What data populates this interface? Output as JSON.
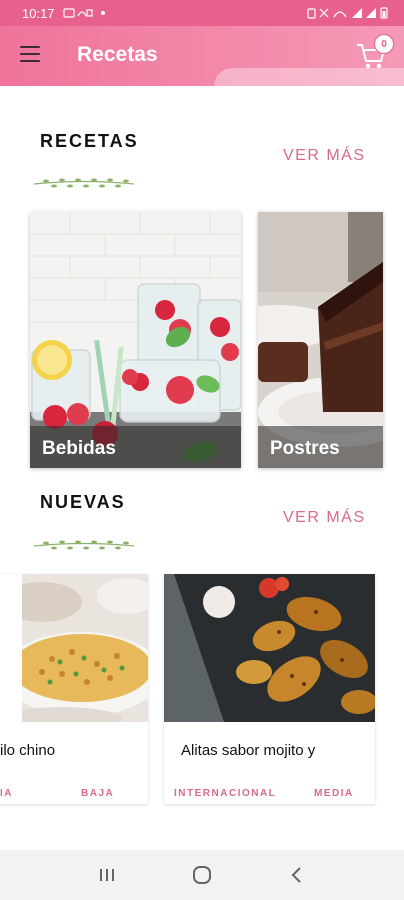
{
  "status_bar": {
    "time": "10:17"
  },
  "app_bar": {
    "title": "Recetas",
    "cart_count": "0"
  },
  "recetas_section": {
    "title": "RECETAS",
    "see_more": "VER MÁS",
    "cards": [
      {
        "label": "Bebidas"
      },
      {
        "label": "Postres"
      }
    ]
  },
  "nuevas_section": {
    "title": "NUEVAS",
    "see_more": "VER MÁS",
    "cards": [
      {
        "title": "ilo chino",
        "tags": [
          "IA",
          "BAJA"
        ]
      },
      {
        "title": "Alitas sabor mojito y",
        "tags": [
          "INTERNACIONAL",
          "MEDIA"
        ]
      }
    ]
  },
  "colors": {
    "primary": "#e8608d",
    "accent": "#d86a8c"
  }
}
